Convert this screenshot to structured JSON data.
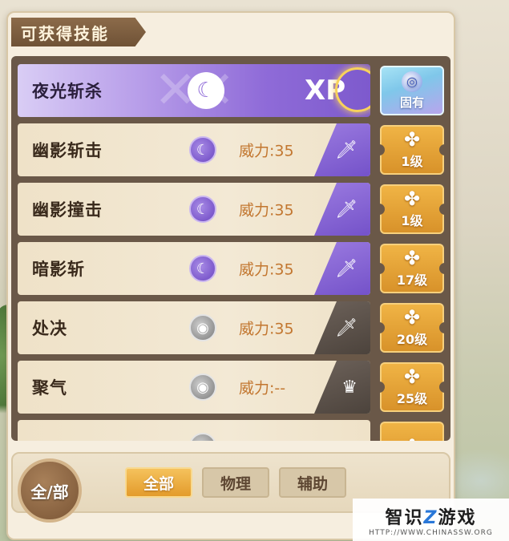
{
  "panel": {
    "title": "可获得技能"
  },
  "skills": [
    {
      "name": "夜光斩杀",
      "badge": "固有",
      "xp": "XP"
    },
    {
      "name": "幽影斩击",
      "power": "威力:35",
      "level": "1级"
    },
    {
      "name": "幽影撞击",
      "power": "威力:35",
      "level": "1级"
    },
    {
      "name": "暗影斩",
      "power": "威力:35",
      "level": "17级"
    },
    {
      "name": "处决",
      "power": "威力:35",
      "level": "20级"
    },
    {
      "name": "聚气",
      "power": "威力:--",
      "level": "25级"
    }
  ],
  "filter": {
    "all_circle": "全/部",
    "tabs": [
      "全部",
      "物理",
      "辅助"
    ],
    "active": "全部"
  },
  "watermark": {
    "main_a": "智识",
    "main_z": "Z",
    "main_b": "游戏",
    "sub": "HTTP://WWW.CHINASSW.ORG"
  },
  "colors": {
    "accent_purple": "#8f6bd8",
    "level_gold": "#e39b2c",
    "power_text": "#c2762f"
  }
}
